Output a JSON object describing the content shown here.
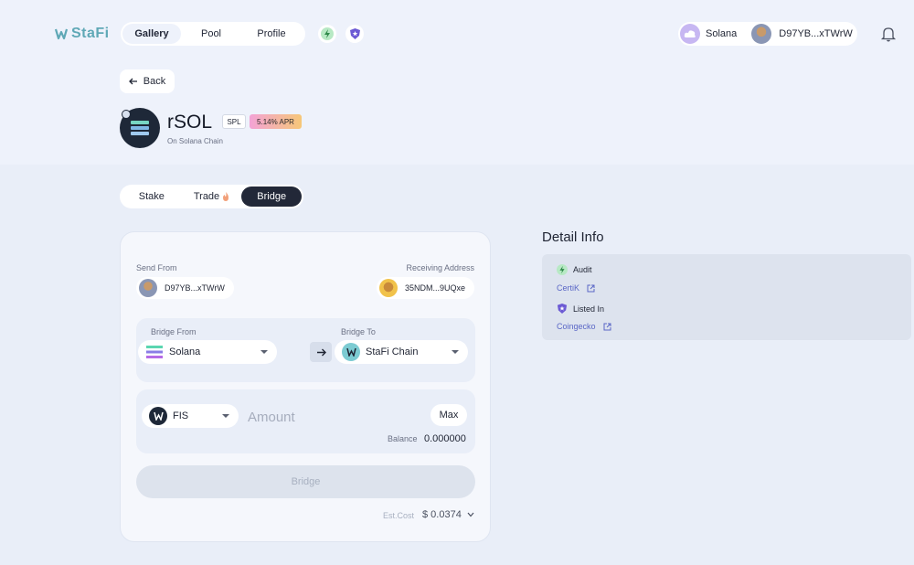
{
  "brand": {
    "name": "StaFi"
  },
  "nav": {
    "items": [
      {
        "label": "Gallery",
        "active": true
      },
      {
        "label": "Pool",
        "active": false
      },
      {
        "label": "Profile",
        "active": false
      }
    ]
  },
  "header_icons": [
    "bolt-icon",
    "shield-icon"
  ],
  "network": {
    "name": "Solana",
    "account": "D97YB...xTWrW"
  },
  "back_label": "Back",
  "token": {
    "name": "rSOL",
    "standard": "SPL",
    "apr": "5.14% APR",
    "chain": "On Solana Chain"
  },
  "tabs": [
    {
      "label": "Stake",
      "active": false
    },
    {
      "label": "Trade",
      "active": false
    },
    {
      "label": "Bridge",
      "active": true
    }
  ],
  "bridge": {
    "send_from_label": "Send From",
    "send_from_address": "D97YB...xTWrW",
    "receiving_label": "Receiving Address",
    "receiving_address": "35NDM...9UQxe",
    "from_label": "Bridge From",
    "from_value": "Solana",
    "to_label": "Bridge To",
    "to_value": "StaFi Chain",
    "asset": "FIS",
    "amount_placeholder": "Amount",
    "max_label": "Max",
    "balance_label": "Balance",
    "balance_value": "0.000000",
    "button_label": "Bridge",
    "cost_label": "Est.Cost",
    "cost_value": "$ 0.0374"
  },
  "detail": {
    "title": "Detail Info",
    "audit_label": "Audit",
    "audit_link": "CertiK",
    "listed_label": "Listed In",
    "listed_link": "Coingecko"
  },
  "colors": {
    "accent_teal": "#5fa8b6",
    "dark": "#222838",
    "link": "#5a67c6"
  }
}
